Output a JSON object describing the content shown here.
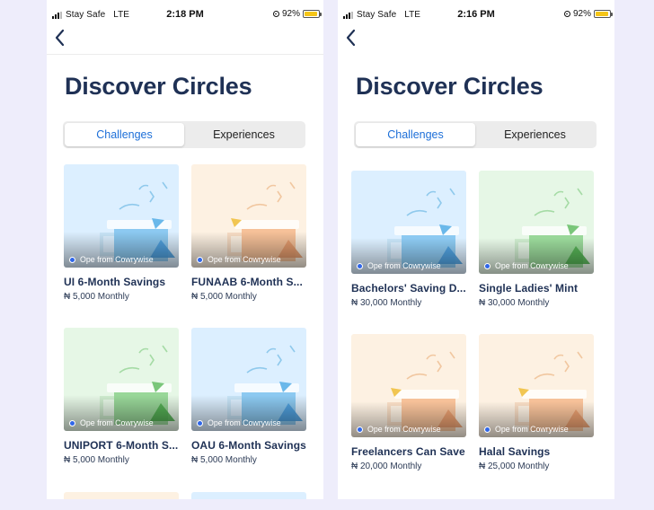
{
  "screens": [
    {
      "status": {
        "carrier": "Stay Safe",
        "network": "LTE",
        "time": "2:18 PM",
        "battery": "92%"
      },
      "title": "Discover Circles",
      "tabs": [
        {
          "label": "Challenges",
          "active": true
        },
        {
          "label": "Experiences",
          "active": false
        }
      ],
      "cards": [
        {
          "title": "UI 6-Month Savings",
          "amount": "₦ 5,000 Monthly",
          "host": "Ope from Cowrywise",
          "theme": "blue"
        },
        {
          "title": "FUNAAB 6-Month  S...",
          "amount": "₦ 5,000 Monthly",
          "host": "Ope from Cowrywise",
          "theme": "peach"
        },
        {
          "title": "UNIPORT 6-Month  S...",
          "amount": "₦ 5,000 Monthly",
          "host": "Ope from Cowrywise",
          "theme": "green"
        },
        {
          "title": "OAU 6-Month  Savings",
          "amount": "₦ 5,000 Monthly",
          "host": "Ope from Cowrywise",
          "theme": "blue"
        }
      ]
    },
    {
      "status": {
        "carrier": "Stay Safe",
        "network": "LTE",
        "time": "2:16 PM",
        "battery": "92%"
      },
      "title": "Discover Circles",
      "tabs": [
        {
          "label": "Challenges",
          "active": true
        },
        {
          "label": "Experiences",
          "active": false
        }
      ],
      "cards": [
        {
          "title": "Bachelors' Saving  D...",
          "amount": "₦ 30,000 Monthly",
          "host": "Ope from Cowrywise",
          "theme": "blue"
        },
        {
          "title": "Single Ladies' Mint",
          "amount": "₦ 30,000 Monthly",
          "host": "Ope from Cowrywise",
          "theme": "green"
        },
        {
          "title": "Freelancers Can  Save",
          "amount": "₦ 20,000 Monthly",
          "host": "Ope from Cowrywise",
          "theme": "peach"
        },
        {
          "title": "Halal Savings",
          "amount": "₦ 25,000 Monthly",
          "host": "Ope from Cowrywise",
          "theme": "peach"
        }
      ]
    }
  ],
  "colors": {
    "background": "#eeedfb",
    "title": "#1f3155",
    "accent": "#1d6fd8",
    "thumb_blue": "#dcefff",
    "thumb_peach": "#fdf1e2",
    "thumb_green": "#e6f7e6"
  },
  "icons": {
    "back": "chevron-left-icon",
    "battery": "battery-icon",
    "lock": "orientation-lock-icon",
    "signal": "signal-icon"
  }
}
